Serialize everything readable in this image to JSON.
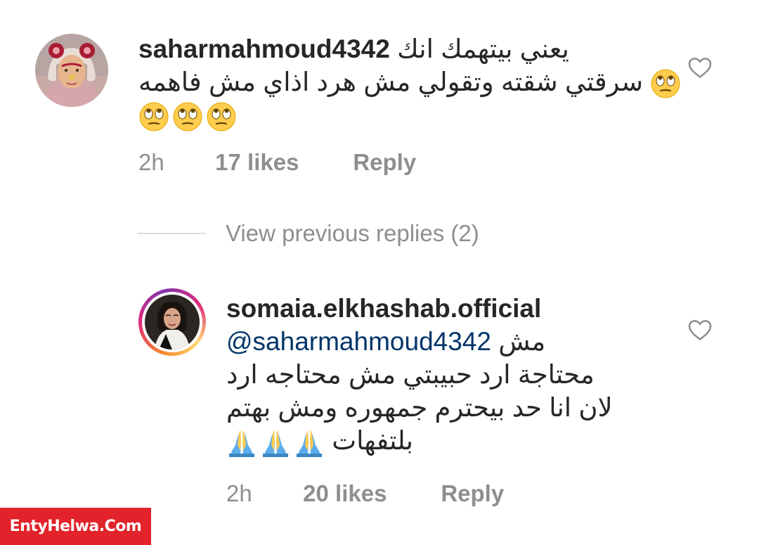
{
  "comments": [
    {
      "username": "saharmahmoud4342",
      "text_line1": "يعني بيتهمك انك",
      "text_line2": "سرقتي شقته وتقولي مش هرد اذاي مش فاهمه",
      "time": "2h",
      "likes": "17 likes",
      "reply": "Reply",
      "emoji_icon": "face-with-rolling-eyes-icon",
      "liked": false
    },
    {
      "username": "somaia.elkhashab.official",
      "mention": "@saharmahmoud4342",
      "text_first": "مش",
      "text_line2": "محتاجة ارد حبيبتي مش محتاجه ارد",
      "text_line3": "لان انا حد بيحترم جمهوره ومش بهتم",
      "text_line4": "بلتفهات",
      "time": "2h",
      "likes": "20 likes",
      "reply": "Reply",
      "emoji_icon": "folded-hands-icon",
      "liked": false
    }
  ],
  "view_previous_replies": "View previous replies (2)",
  "watermark": "EntyHelwa.Com",
  "colors": {
    "mention": "#003569",
    "meta_gray": "#8e8e8e",
    "watermark_red": "#e2232b"
  }
}
